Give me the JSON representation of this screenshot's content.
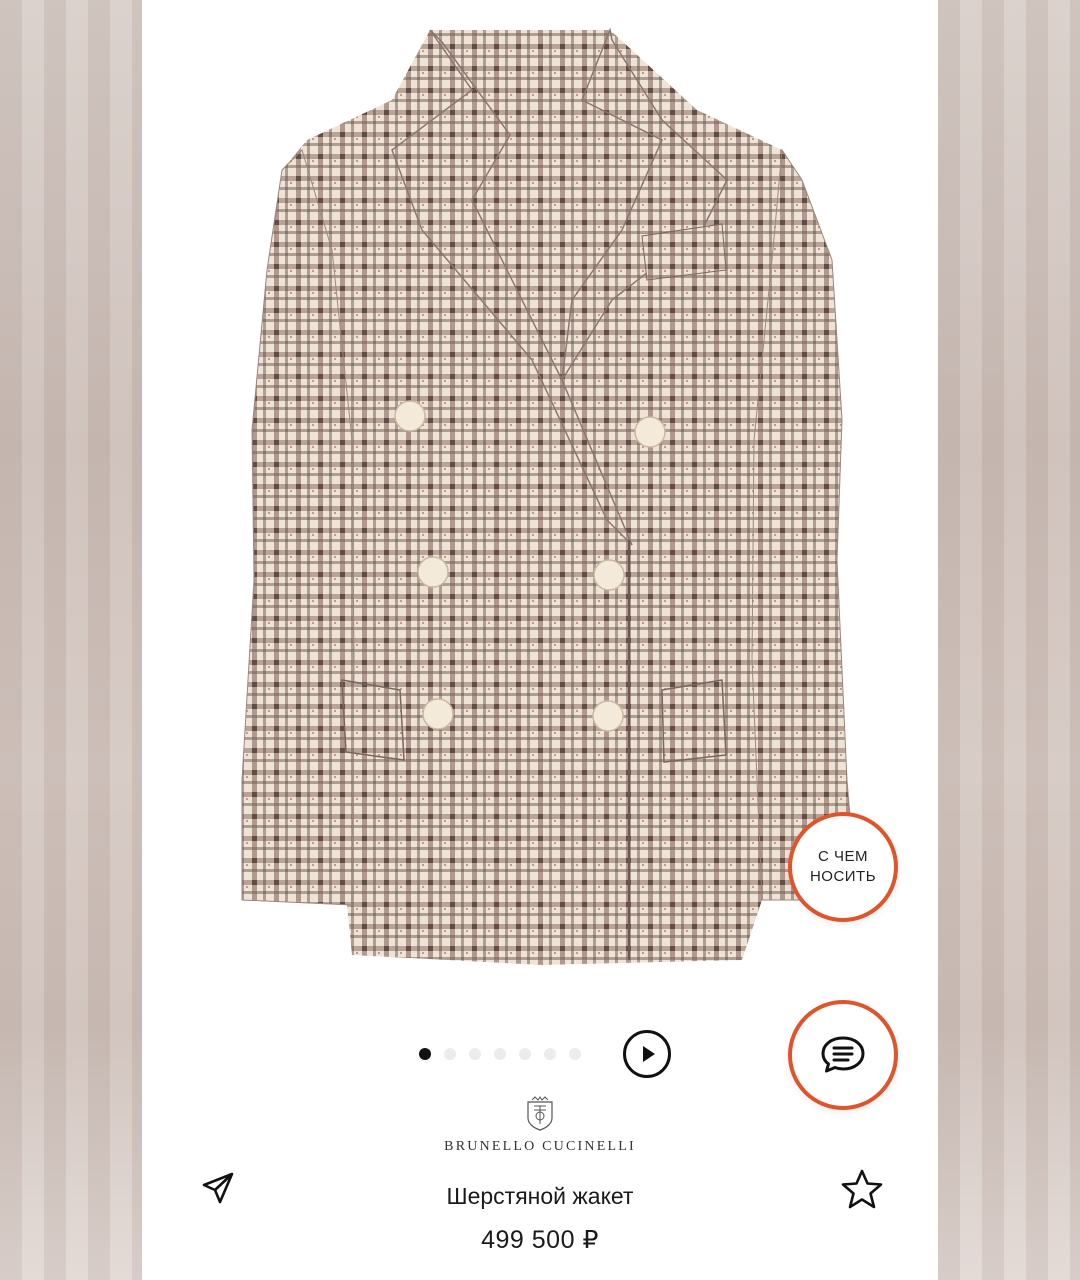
{
  "product": {
    "brand": "BRUNELLO CUCINELLI",
    "title": "Шерстяной жакет",
    "price": "499 500 ₽"
  },
  "fab": {
    "outfit_line1": "С ЧЕМ",
    "outfit_line2": "НОСИТЬ",
    "chat_icon": "chat-bubble-icon"
  },
  "gallery": {
    "total_images": 7,
    "active_index": 0,
    "video_icon": "play-icon"
  },
  "actions": {
    "share_icon": "send-icon",
    "favorite_icon": "star-icon"
  },
  "colors": {
    "accent": "#e0542b",
    "text": "#1a1a1a",
    "dot_active": "#111111",
    "dot_inactive": "#ececec"
  }
}
